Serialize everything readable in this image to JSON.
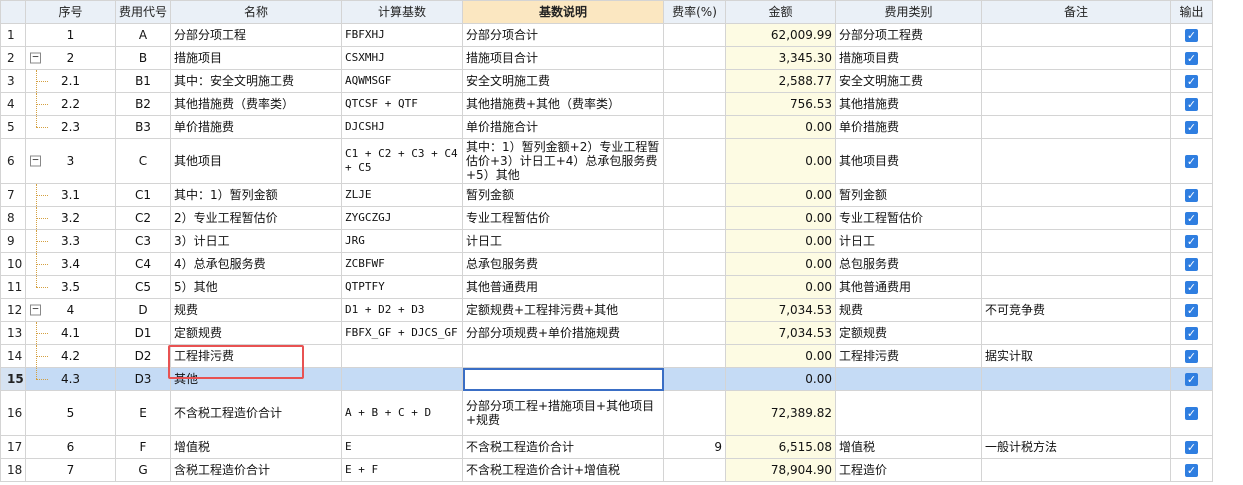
{
  "columns": [
    "序号",
    "费用代号",
    "名称",
    "计算基数",
    "基数说明",
    "费率(%)",
    "金额",
    "费用类别",
    "备注",
    "输出"
  ],
  "rows": [
    {
      "n": "1",
      "seq": "1",
      "code": "A",
      "name": "分部分项工程",
      "base": "FBFXHJ",
      "desc": "分部分项合计",
      "rate": "",
      "amount": "62,009.99",
      "cat": "分部分项工程费",
      "note": ""
    },
    {
      "n": "2",
      "seq": "2",
      "code": "B",
      "name": "措施项目",
      "base": "CSXMHJ",
      "desc": "措施项目合计",
      "rate": "",
      "amount": "3,345.30",
      "cat": "措施项目费",
      "note": ""
    },
    {
      "n": "3",
      "seq": "2.1",
      "code": "B1",
      "name": "其中：安全文明施工费",
      "base": "AQWMSGF",
      "desc": "安全文明施工费",
      "rate": "",
      "amount": "2,588.77",
      "cat": "安全文明施工费",
      "note": ""
    },
    {
      "n": "4",
      "seq": "2.2",
      "code": "B2",
      "name": "其他措施费（费率类）",
      "base": "QTCSF + QTF",
      "desc": "其他措施费+其他（费率类）",
      "rate": "",
      "amount": "756.53",
      "cat": "其他措施费",
      "note": ""
    },
    {
      "n": "5",
      "seq": "2.3",
      "code": "B3",
      "name": "单价措施费",
      "base": "DJCSHJ",
      "desc": "单价措施合计",
      "rate": "",
      "amount": "0.00",
      "cat": "单价措施费",
      "note": ""
    },
    {
      "n": "6",
      "seq": "3",
      "code": "C",
      "name": "其他项目",
      "base": "C1 + C2 + C3 + C4 + C5",
      "desc": "其中：1）暂列金额+2）专业工程暂估价+3）计日工+4）总承包服务费+5）其他",
      "rate": "",
      "amount": "0.00",
      "cat": "其他项目费",
      "note": ""
    },
    {
      "n": "7",
      "seq": "3.1",
      "code": "C1",
      "name": "其中：1）暂列金额",
      "base": "ZLJE",
      "desc": "暂列金额",
      "rate": "",
      "amount": "0.00",
      "cat": "暂列金额",
      "note": ""
    },
    {
      "n": "8",
      "seq": "3.2",
      "code": "C2",
      "name": "2）专业工程暂估价",
      "base": "ZYGCZGJ",
      "desc": "专业工程暂估价",
      "rate": "",
      "amount": "0.00",
      "cat": "专业工程暂估价",
      "note": ""
    },
    {
      "n": "9",
      "seq": "3.3",
      "code": "C3",
      "name": "3）计日工",
      "base": "JRG",
      "desc": "计日工",
      "rate": "",
      "amount": "0.00",
      "cat": "计日工",
      "note": ""
    },
    {
      "n": "10",
      "seq": "3.4",
      "code": "C4",
      "name": "4）总承包服务费",
      "base": "ZCBFWF",
      "desc": "总承包服务费",
      "rate": "",
      "amount": "0.00",
      "cat": "总包服务费",
      "note": ""
    },
    {
      "n": "11",
      "seq": "3.5",
      "code": "C5",
      "name": "5）其他",
      "base": "QTPTFY",
      "desc": "其他普通费用",
      "rate": "",
      "amount": "0.00",
      "cat": "其他普通费用",
      "note": ""
    },
    {
      "n": "12",
      "seq": "4",
      "code": "D",
      "name": "规费",
      "base": "D1 + D2 + D3",
      "desc": "定额规费+工程排污费+其他",
      "rate": "",
      "amount": "7,034.53",
      "cat": "规费",
      "note": "不可竞争费"
    },
    {
      "n": "13",
      "seq": "4.1",
      "code": "D1",
      "name": "定额规费",
      "base": "FBFX_GF + DJCS_GF",
      "desc": "分部分项规费+单价措施规费",
      "rate": "",
      "amount": "7,034.53",
      "cat": "定额规费",
      "note": ""
    },
    {
      "n": "14",
      "seq": "4.2",
      "code": "D2",
      "name": "工程排污费",
      "base": "",
      "desc": "",
      "rate": "",
      "amount": "0.00",
      "cat": "工程排污费",
      "note": "据实计取"
    },
    {
      "n": "15",
      "seq": "4.3",
      "code": "D3",
      "name": "其他",
      "base": "",
      "desc": "",
      "rate": "",
      "amount": "0.00",
      "cat": "",
      "note": ""
    },
    {
      "n": "16",
      "seq": "5",
      "code": "E",
      "name": "不含税工程造价合计",
      "base": "A + B + C + D",
      "desc": "分部分项工程+措施项目+其他项目+规费",
      "rate": "",
      "amount": "72,389.82",
      "cat": "",
      "note": ""
    },
    {
      "n": "17",
      "seq": "6",
      "code": "F",
      "name": "增值税",
      "base": "E",
      "desc": "不含税工程造价合计",
      "rate": "9",
      "amount": "6,515.08",
      "cat": "增值税",
      "note": "一般计税方法"
    },
    {
      "n": "18",
      "seq": "7",
      "code": "G",
      "name": "含税工程造价合计",
      "base": "E + F",
      "desc": "不含税工程造价合计+增值税",
      "rate": "",
      "amount": "78,904.90",
      "cat": "工程造价",
      "note": ""
    }
  ],
  "checkbox_glyph": "✓",
  "collapse_glyph": "−",
  "accent": "#2f7ee0",
  "highlight": "#e85252"
}
